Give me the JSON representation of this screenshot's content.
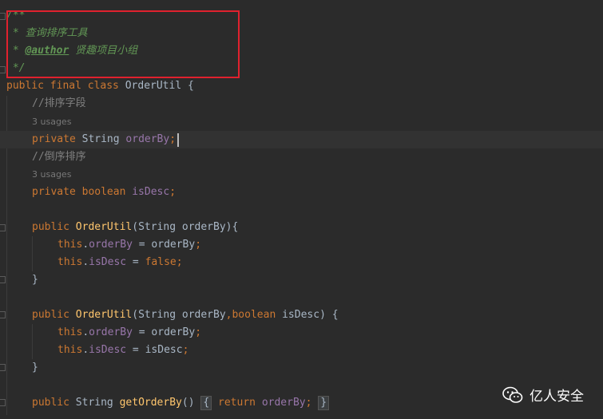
{
  "code": {
    "doc_open": "/**",
    "doc_line_1": " * 查询排序工具",
    "doc_line_2_prefix": " * ",
    "doc_line_2_tag": "@author",
    "doc_line_2_text": " 贤趣项目小组",
    "doc_close": " */",
    "class_decl_kw": "public final class ",
    "class_name": "OrderUtil",
    "class_open": " {",
    "comment_sort_field": "//排序字段",
    "usages_1": "3 usages",
    "field1_kw": "private ",
    "field1_type": "String ",
    "field1_name": "orderBy",
    "field1_semi": ";",
    "comment_desc": "//倒序排序",
    "usages_2": "3 usages",
    "field2_kw": "private boolean ",
    "field2_name": "isDesc",
    "field2_semi": ";",
    "ctor1_kw": "public ",
    "ctor1_name": "OrderUtil",
    "ctor1_params": "(String orderBy){",
    "ctor1_l1_this": "this",
    "ctor1_l1_dot": ".",
    "ctor1_l1_field": "orderBy",
    "ctor1_l1_rest": " = orderBy",
    "ctor1_l1_semi": ";",
    "ctor1_l2_this": "this",
    "ctor1_l2_dot": ".",
    "ctor1_l2_field": "isDesc",
    "ctor1_l2_rest": " = ",
    "ctor1_l2_val": "false",
    "ctor1_l2_semi": ";",
    "close_brace": "}",
    "ctor2_kw": "public ",
    "ctor2_name": "OrderUtil",
    "ctor2_p1": "(String orderBy",
    "ctor2_comma": ",",
    "ctor2_bool": "boolean ",
    "ctor2_p2": "isDesc) {",
    "ctor2_l1_this": "this",
    "ctor2_l1_dot": ".",
    "ctor2_l1_field": "orderBy",
    "ctor2_l1_rest": " = orderBy",
    "ctor2_l1_semi": ";",
    "ctor2_l2_this": "this",
    "ctor2_l2_dot": ".",
    "ctor2_l2_field": "isDesc",
    "ctor2_l2_rest": " = isDesc",
    "ctor2_l2_semi": ";",
    "getter_kw": "public ",
    "getter_type": "String ",
    "getter_name": "getOrderBy",
    "getter_parens": "() ",
    "getter_open": "{",
    "getter_return": " return ",
    "getter_field": "orderBy",
    "getter_semi": "; ",
    "getter_close": "}"
  },
  "watermark": {
    "text": "亿人安全",
    "icon": "wechat-icon"
  },
  "colors": {
    "background": "#2b2b2b",
    "keyword": "#cc7832",
    "field": "#9876aa",
    "method": "#ffc66d",
    "doc": "#629755",
    "highlight": "#e0212e"
  }
}
